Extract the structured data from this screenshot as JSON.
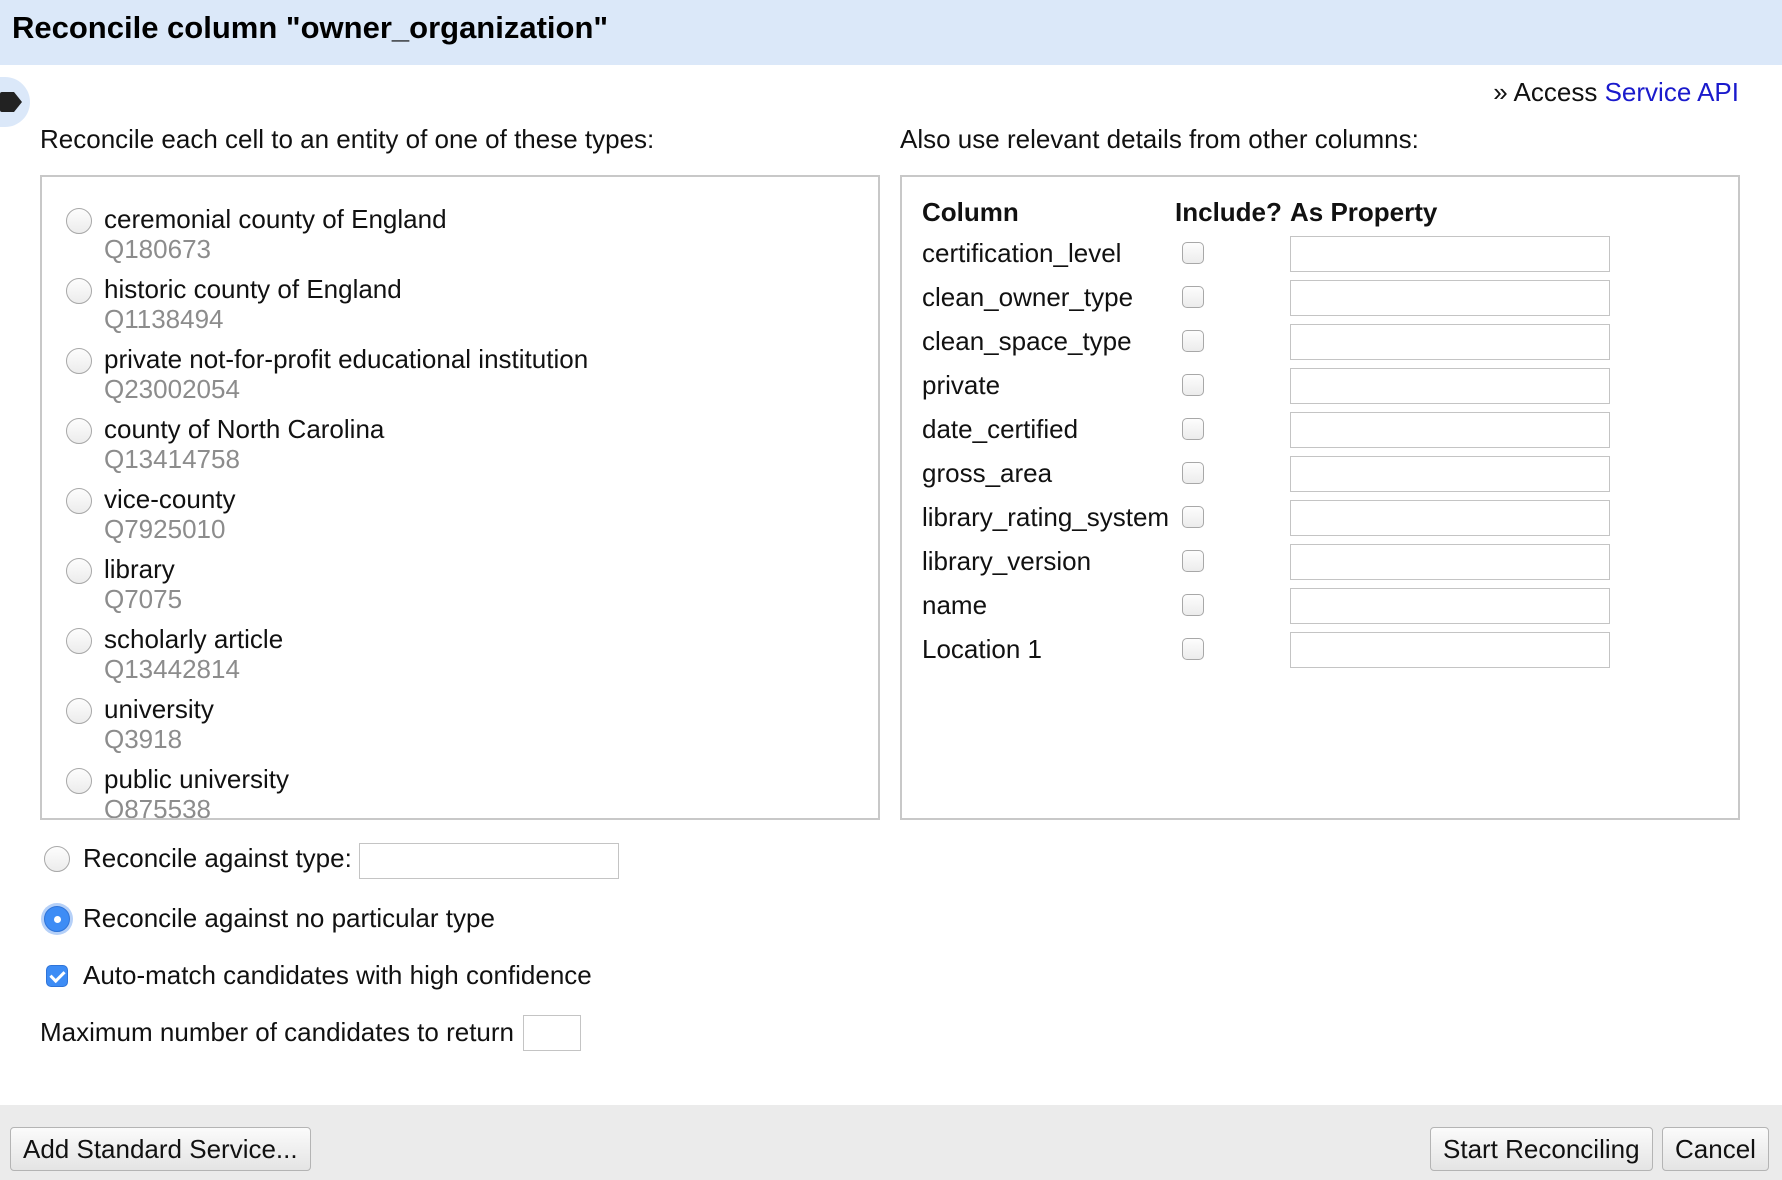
{
  "dialog": {
    "title": "Reconcile column \"owner_organization\""
  },
  "service_link": {
    "prefix": "» Access",
    "link_label": "Service API"
  },
  "types_section": {
    "label": "Reconcile each cell to an entity of one of these types:",
    "types": [
      {
        "name": "ceremonial county of England",
        "id": "Q180673"
      },
      {
        "name": "historic county of England",
        "id": "Q1138494"
      },
      {
        "name": "private not-for-profit educational institution",
        "id": "Q23002054"
      },
      {
        "name": "county of North Carolina",
        "id": "Q13414758"
      },
      {
        "name": "vice-county",
        "id": "Q7925010"
      },
      {
        "name": "library",
        "id": "Q7075"
      },
      {
        "name": "scholarly article",
        "id": "Q13442814"
      },
      {
        "name": "university",
        "id": "Q3918"
      },
      {
        "name": "public university",
        "id": "Q875538"
      }
    ]
  },
  "columns_section": {
    "label": "Also use relevant details from other columns:",
    "headers": {
      "column": "Column",
      "include": "Include?",
      "property": "As Property"
    },
    "rows": [
      {
        "name": "certification_level"
      },
      {
        "name": "clean_owner_type"
      },
      {
        "name": "clean_space_type"
      },
      {
        "name": "private"
      },
      {
        "name": "date_certified"
      },
      {
        "name": "gross_area"
      },
      {
        "name": "library_rating_system"
      },
      {
        "name": "library_version"
      },
      {
        "name": "name"
      },
      {
        "name": "Location 1"
      }
    ]
  },
  "options": {
    "against_type_label": "Reconcile against type:",
    "no_type_label": "Reconcile against no particular type",
    "no_type_selected": true,
    "auto_match_label": "Auto-match candidates with high confidence",
    "auto_match_checked": true,
    "max_candidates_label": "Maximum number of candidates to return"
  },
  "footer": {
    "add_service_label": "Add Standard Service...",
    "start_label": "Start Reconciling",
    "cancel_label": "Cancel"
  },
  "colors": {
    "title_bar": "#dbe8f9",
    "link": "#1a1acc",
    "accent": "#3d8cf5"
  }
}
